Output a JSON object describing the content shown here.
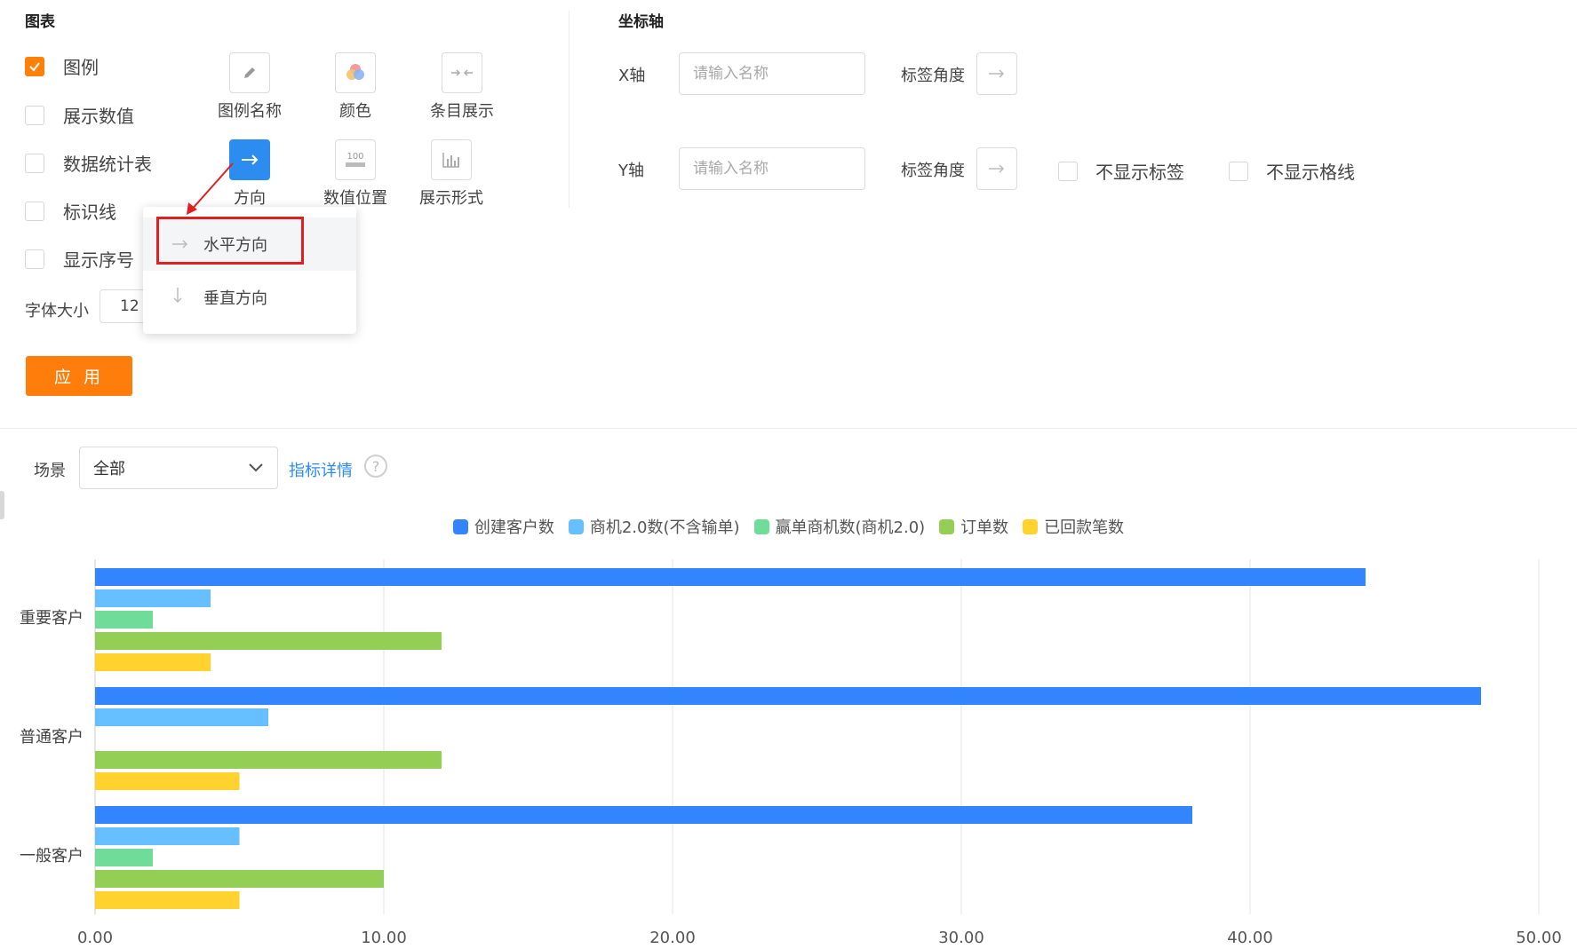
{
  "chart_panel": {
    "title": "图表",
    "checkboxes": [
      {
        "label": "图例",
        "checked": true
      },
      {
        "label": "展示数值",
        "checked": false
      },
      {
        "label": "数据统计表",
        "checked": false
      },
      {
        "label": "标识线",
        "checked": false
      },
      {
        "label": "显示序号",
        "checked": false
      }
    ],
    "tools": {
      "legend_name": "图例名称",
      "color": "颜色",
      "item_display": "条目展示",
      "direction": "方向",
      "value_position": "数值位置",
      "display_form": "展示形式"
    },
    "value_icon_text": "100",
    "font_size_label": "字体大小",
    "font_size_value": "12",
    "apply_label": "应 用"
  },
  "direction_dropdown": {
    "options": [
      {
        "label": "水平方向",
        "selected": true
      },
      {
        "label": "垂直方向",
        "selected": false
      }
    ]
  },
  "axis_panel": {
    "title": "坐标轴",
    "x_label": "X轴",
    "y_label": "Y轴",
    "name_placeholder": "请输入名称",
    "angle_label": "标签角度",
    "hide_labels": "不显示标签",
    "hide_grid": "不显示格线"
  },
  "filter": {
    "scene_label": "场景",
    "scene_value": "全部",
    "metric_link": "指标详情",
    "help_glyph": "?"
  },
  "colors": {
    "accent": "#ff7d0a",
    "active_tool": "#2d8cf0",
    "highlight": "#e02020"
  },
  "chart_data": {
    "type": "bar",
    "orientation": "horizontal",
    "categories": [
      "重要客户",
      "普通客户",
      "一般客户"
    ],
    "series": [
      {
        "name": "创建客户数",
        "color": "#3385ff",
        "values": [
          44,
          48,
          38
        ]
      },
      {
        "name": "商机2.0数(不含输单)",
        "color": "#66bfff",
        "values": [
          4,
          6,
          5
        ]
      },
      {
        "name": "赢单商机数(商机2.0)",
        "color": "#6fdc9a",
        "values": [
          2,
          0,
          2
        ]
      },
      {
        "name": "订单数",
        "color": "#93cf55",
        "values": [
          12,
          12,
          10
        ]
      },
      {
        "name": "已回款笔数",
        "color": "#ffd22e",
        "values": [
          4,
          5,
          5
        ]
      }
    ],
    "xlim": [
      0,
      50
    ],
    "ticks": [
      "0.00",
      "10.00",
      "20.00",
      "30.00",
      "40.00",
      "50.00"
    ],
    "grid": true,
    "legend_position": "top-center"
  }
}
